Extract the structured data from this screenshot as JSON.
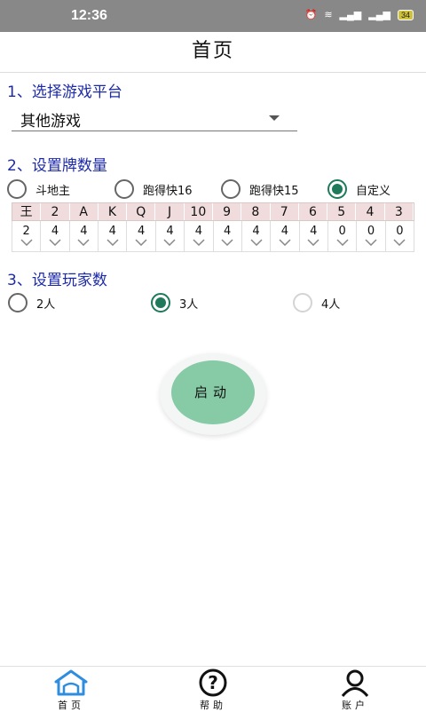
{
  "status": {
    "time": "12:36",
    "battery": "34"
  },
  "header": {
    "title": "首页"
  },
  "section1": {
    "title": "1、选择游戏平台",
    "selected": "其他游戏"
  },
  "section2": {
    "title": "2、设置牌数量",
    "options": [
      "斗地主",
      "跑得快16",
      "跑得快15",
      "自定义"
    ],
    "selected_index": 3,
    "cards": [
      "王",
      "2",
      "A",
      "K",
      "Q",
      "J",
      "10",
      "9",
      "8",
      "7",
      "6",
      "5",
      "4",
      "3"
    ],
    "counts": [
      "2",
      "4",
      "4",
      "4",
      "4",
      "4",
      "4",
      "4",
      "4",
      "4",
      "4",
      "0",
      "0",
      "0"
    ]
  },
  "section3": {
    "title": "3、设置玩家数",
    "options": [
      "2人",
      "3人",
      "4人"
    ],
    "selected_index": 1
  },
  "start_button": {
    "label": "启动"
  },
  "tabs": [
    {
      "label": "首页",
      "icon": "home-icon"
    },
    {
      "label": "帮助",
      "icon": "help-icon"
    },
    {
      "label": "账户",
      "icon": "user-icon"
    }
  ],
  "colors": {
    "accent": "#1f7a5c",
    "section_title": "#1c2aa8",
    "start_button": "#86caa6"
  }
}
